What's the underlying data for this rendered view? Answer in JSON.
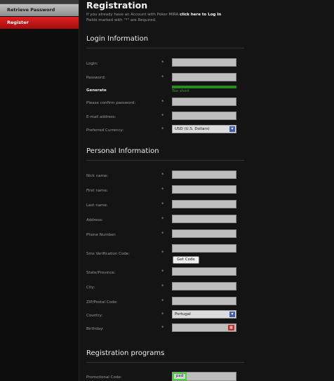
{
  "sidebar": {
    "items": [
      {
        "label": "Retrieve Password"
      },
      {
        "label": "Register"
      }
    ]
  },
  "header": {
    "title": "Registration",
    "intro_prefix": "If you already have an Account with Poker MIRA",
    "intro_link": "click here to Log In",
    "intro_line2": "Fields marked with \"*\" are Required."
  },
  "login_section": {
    "title": "Login Information",
    "login_label": "Login:",
    "password_label": "Password:",
    "generate_label": "Generate",
    "strength_text": "Too short",
    "strength_color": "#2a8a1e",
    "confirm_label": "Please confirm password:",
    "email_label": "E-mail address:",
    "currency_label": "Preferred Currency:",
    "currency_value": "USD  (U.S. Dollars)"
  },
  "personal_section": {
    "title": "Personal Information",
    "nick_label": "Nick name:",
    "first_label": "First name:",
    "last_label": "Last name:",
    "address_label": "Address:",
    "phone_label": "Phone Number:",
    "sms_label": "Sms Verification Code:",
    "get_code_label": "Get Code",
    "state_label": "State/Province:",
    "city_label": "City:",
    "zip_label": "ZIP/Postal Code:",
    "country_label": "Country:",
    "country_value": "Portugal",
    "birthday_label": "Birthday:"
  },
  "programs_section": {
    "title": "Registration programs",
    "promo_label": "Promotional Code:",
    "promo_value": "pxd"
  },
  "required_mark": "*",
  "colors": {
    "register_active": "#c41414",
    "strength_bar": "#2a8a1e",
    "promo_focus": "#3fd43f"
  }
}
